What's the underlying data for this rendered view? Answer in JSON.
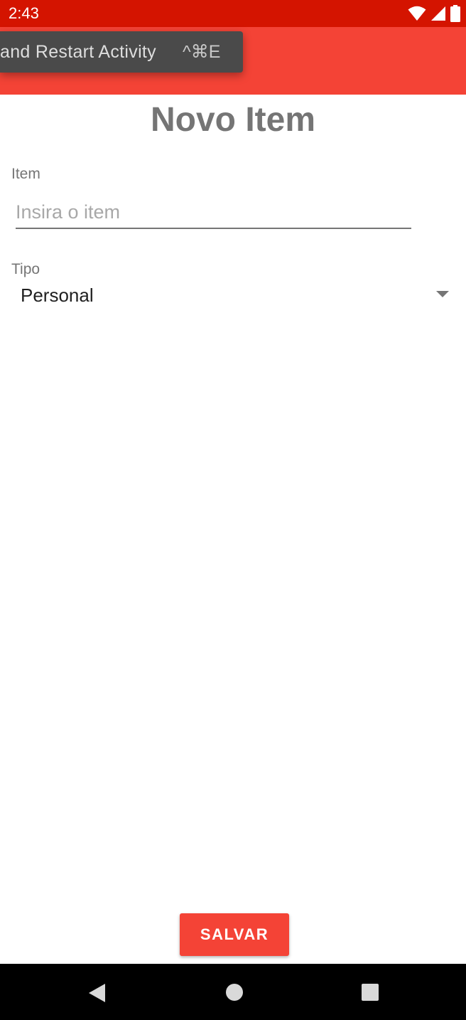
{
  "status_bar": {
    "time": "2:43",
    "icons": [
      "wifi-icon",
      "cell-signal-icon",
      "battery-icon"
    ]
  },
  "tooltip": {
    "label": "and Restart Activity",
    "shortcut": "^⌘E"
  },
  "page": {
    "title": "Novo Item"
  },
  "form": {
    "item_label": "Item",
    "item_placeholder": "Insira o item",
    "item_value": "",
    "tipo_label": "Tipo",
    "tipo_selected": "Personal"
  },
  "actions": {
    "save_label": "SALVAR"
  },
  "nav_bar": {
    "icons": [
      "back-icon",
      "home-icon",
      "recents-icon"
    ]
  },
  "colors": {
    "status_bar": "#d41400",
    "app_bar": "#f44336",
    "accent": "#f44336",
    "title_text": "#757575"
  }
}
